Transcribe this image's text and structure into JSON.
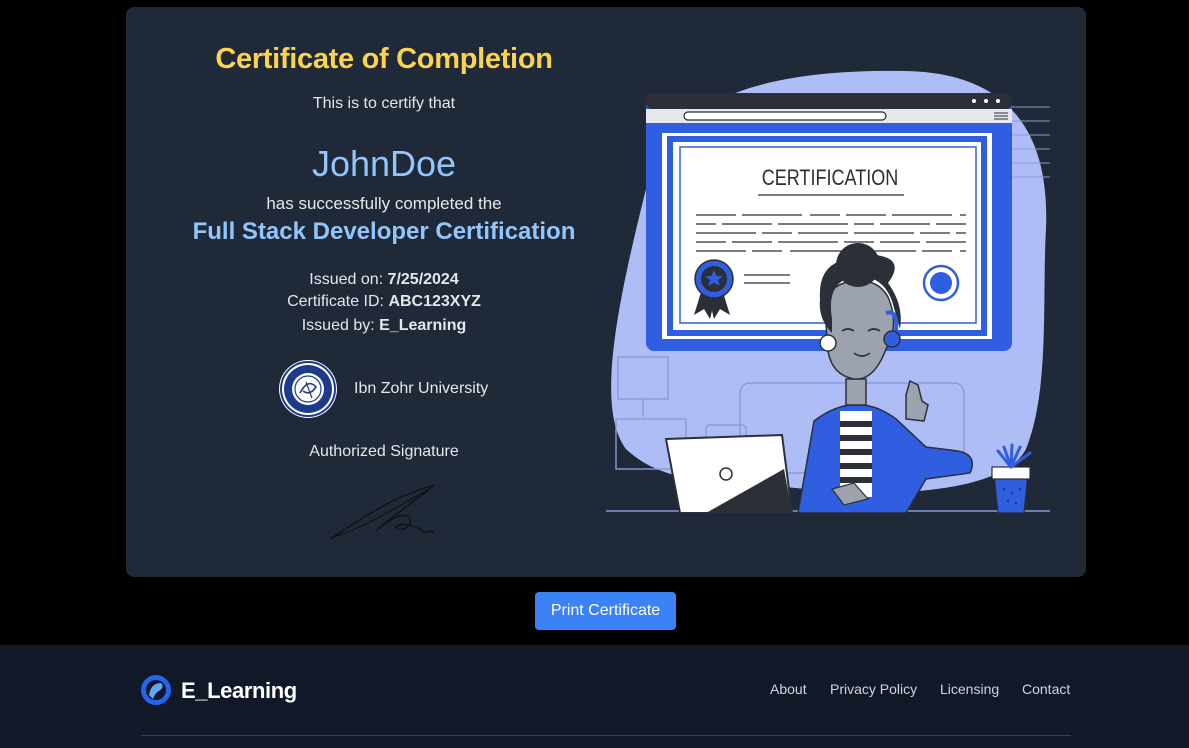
{
  "certificate": {
    "title": "Certificate of Completion",
    "certify_text": "This is to certify that",
    "recipient_name": "JohnDoe",
    "completed_text": "has successfully completed the",
    "course_name": "Full Stack Developer Certification",
    "issued_on_label": "Issued on:",
    "issued_on_value": "7/25/2024",
    "certificate_id_label": "Certificate ID:",
    "certificate_id_value": "ABC123XYZ",
    "issued_by_label": "Issued by:",
    "issued_by_value": "E_Learning",
    "university": "Ibn Zohr University",
    "authorized_signature": "Authorized Signature",
    "illustration_heading": "CERTIFICATION"
  },
  "actions": {
    "print_label": "Print Certificate"
  },
  "footer": {
    "brand": "E_Learning",
    "links": [
      "About",
      "Privacy Policy",
      "Licensing",
      "Contact"
    ]
  },
  "colors": {
    "page_bg": "#000000",
    "card_bg": "#1f2937",
    "title_yellow": "#fcd34d",
    "highlight_blue": "#93c5fd",
    "button_blue": "#3b82f6",
    "footer_bg": "#111827",
    "illustration_blue": "#2f5ee0",
    "illustration_light": "#aebdf5"
  }
}
